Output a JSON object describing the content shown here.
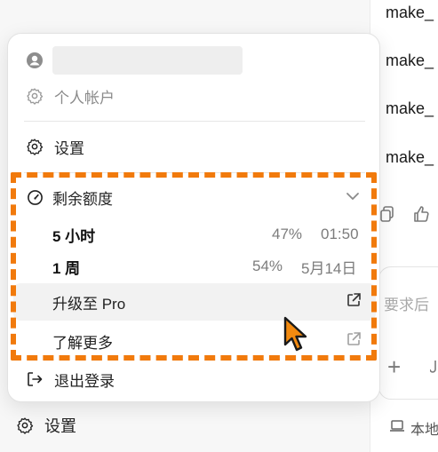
{
  "colors": {
    "accent_dash": "#f17a0c",
    "cursor": "#f28a10"
  },
  "right_panel": {
    "items": [
      "make_",
      "make_",
      "make_",
      "make_"
    ],
    "input_placeholder": "要求后",
    "local_label": "本地"
  },
  "sidebar": {
    "settings_label": "设置"
  },
  "menu": {
    "account_label": "个人帐户",
    "settings_label": "设置",
    "quota": {
      "title": "剩余额度",
      "rows": [
        {
          "label": "5 小时",
          "percent": "47%",
          "time": "01:50"
        },
        {
          "label": "1 周",
          "percent": "54%",
          "time": "5月14日"
        }
      ]
    },
    "upgrade_label": "升级至 Pro",
    "learn_more_label": "了解更多",
    "logout_label": "退出登录"
  }
}
